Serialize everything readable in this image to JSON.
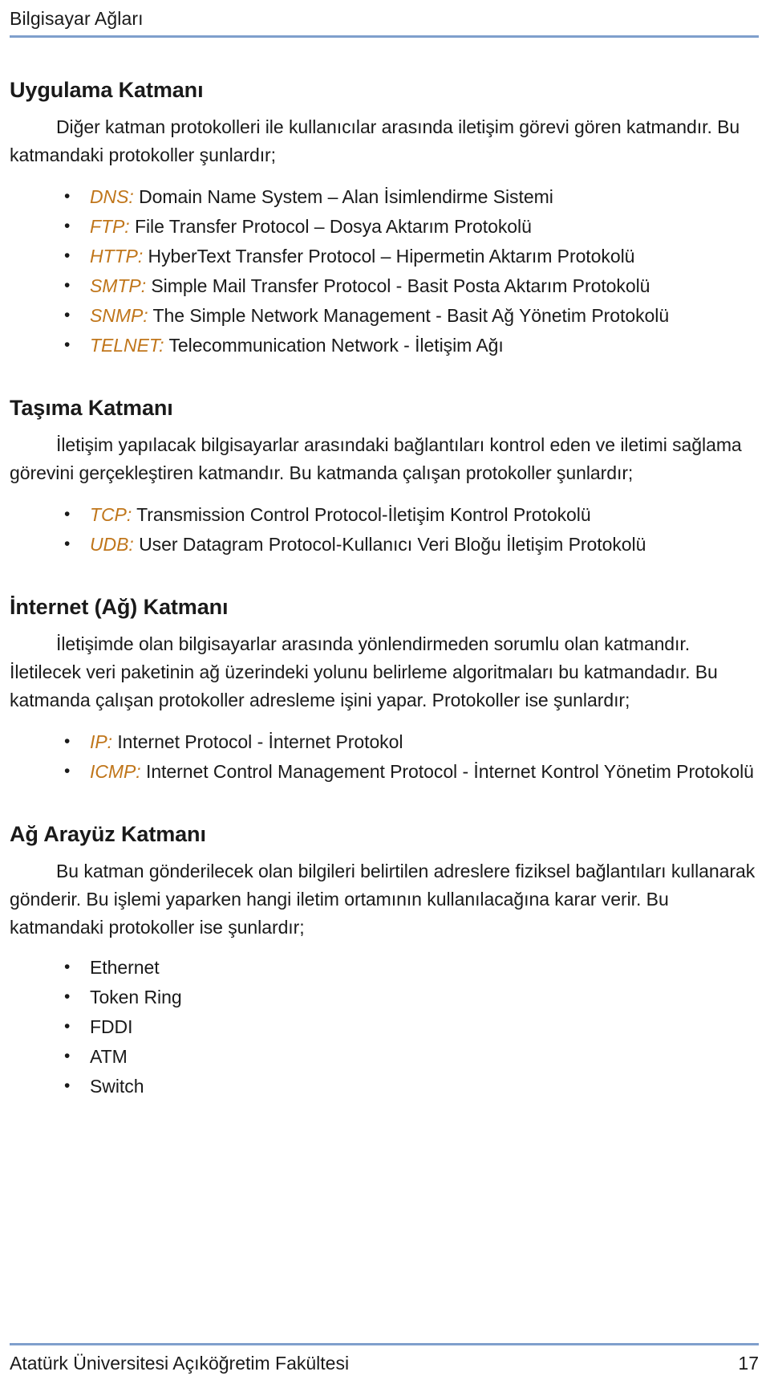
{
  "header": {
    "title": "Bilgisayar Ağları",
    "rule_color": "#7f9fcc"
  },
  "accent_color": "#c0761b",
  "sections": [
    {
      "heading": "Uygulama Katmanı",
      "paragraph": "Diğer katman protokolleri ile kullanıcılar arasında iletişim görevi gören katmandır. Bu katmandaki protokoller şunlardır;",
      "items": [
        {
          "abbr": "DNS:",
          "text": " Domain Name System – Alan İsimlendirme Sistemi"
        },
        {
          "abbr": "FTP:",
          "text": " File Transfer Protocol – Dosya Aktarım Protokolü"
        },
        {
          "abbr": "HTTP:",
          "text": " HyberText Transfer Protocol – Hipermetin Aktarım Protokolü"
        },
        {
          "abbr": "SMTP:",
          "text": " Simple Mail Transfer Protocol - Basit Posta Aktarım Protokolü"
        },
        {
          "abbr": "SNMP:",
          "text": " The Simple Network Management - Basit Ağ Yönetim Protokolü"
        },
        {
          "abbr": "TELNET:",
          "text": " Telecommunication Network - İletişim Ağı"
        }
      ]
    },
    {
      "heading": "Taşıma Katmanı",
      "paragraph": "İletişim yapılacak bilgisayarlar arasındaki bağlantıları kontrol eden ve iletimi sağlama görevini gerçekleştiren katmandır. Bu katmanda çalışan protokoller şunlardır;",
      "items": [
        {
          "abbr": "TCP:",
          "text": " Transmission Control Protocol-İletişim Kontrol Protokolü"
        },
        {
          "abbr": "UDB:",
          "text": " User Datagram Protocol-Kullanıcı Veri Bloğu İletişim Protokolü"
        }
      ]
    },
    {
      "heading": "İnternet (Ağ) Katmanı",
      "paragraph": "İletişimde olan bilgisayarlar arasında yönlendirmeden sorumlu olan katmandır. İletilecek veri paketinin ağ üzerindeki yolunu belirleme algoritmaları bu katmandadır. Bu katmanda çalışan protokoller adresleme işini yapar. Protokoller ise şunlardır;",
      "items": [
        {
          "abbr": "IP:",
          "text": " Internet Protocol - İnternet Protokol"
        },
        {
          "abbr": "ICMP:",
          "text": " Internet Control Management Protocol - İnternet Kontrol Yönetim Protokolü"
        }
      ]
    },
    {
      "heading": "Ağ Arayüz Katmanı",
      "paragraph": "Bu katman gönderilecek olan bilgileri belirtilen adreslere fiziksel bağlantıları kullanarak gönderir. Bu işlemi yaparken hangi iletim ortamının kullanılacağına karar verir. Bu katmandaki protokoller ise şunlardır;",
      "items": [
        {
          "abbr": "",
          "text": "Ethernet"
        },
        {
          "abbr": "",
          "text": "Token Ring"
        },
        {
          "abbr": "",
          "text": "FDDI"
        },
        {
          "abbr": "",
          "text": "ATM"
        },
        {
          "abbr": "",
          "text": "Switch"
        }
      ]
    }
  ],
  "footer": {
    "text": "Atatürk Üniversitesi Açıköğretim Fakültesi",
    "page_number": "17",
    "rule_color": "#7f9fcc"
  }
}
